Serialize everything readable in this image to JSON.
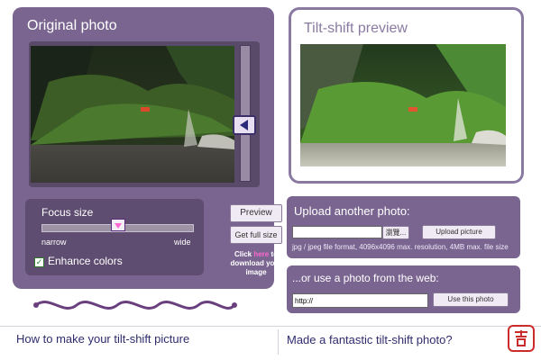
{
  "left_panel": {
    "title": "Original photo",
    "focus": {
      "label": "Focus size",
      "narrow": "narrow",
      "wide": "wide",
      "enhance_label": "Enhance colors",
      "enhance_checked": true
    },
    "buttons": {
      "preview": "Preview",
      "get_full_size": "Get full size"
    },
    "download_note": {
      "prefix": "Click",
      "link": "here",
      "suffix": "to download your image"
    }
  },
  "right_panel": {
    "title": "Tilt-shift preview"
  },
  "upload": {
    "title": "Upload another photo:",
    "browse_label": "瀏覽...",
    "upload_button": "Upload picture",
    "info": "jpg / jpeg file format, 4096x4096 max. resolution, 4MB max. file size"
  },
  "web": {
    "title": "...or use a photo from the web:",
    "url_value": "http://",
    "use_button": "Use this photo"
  },
  "bottom": {
    "left_link": "How to make your tilt-shift picture",
    "right_link": "Made a fantastic tilt-shift photo?"
  },
  "colors": {
    "panel_purple": "#7a6590",
    "dark_purple": "#5e4d70",
    "accent_pink": "#ff66d0",
    "link_blue": "#2f2c6d"
  },
  "icons": {
    "vertical_slider_handle": "left-arrow-icon",
    "size_slider_handle": "down-arrow-icon",
    "checkbox_mark": "check-icon",
    "seal": "red-seal-icon"
  }
}
